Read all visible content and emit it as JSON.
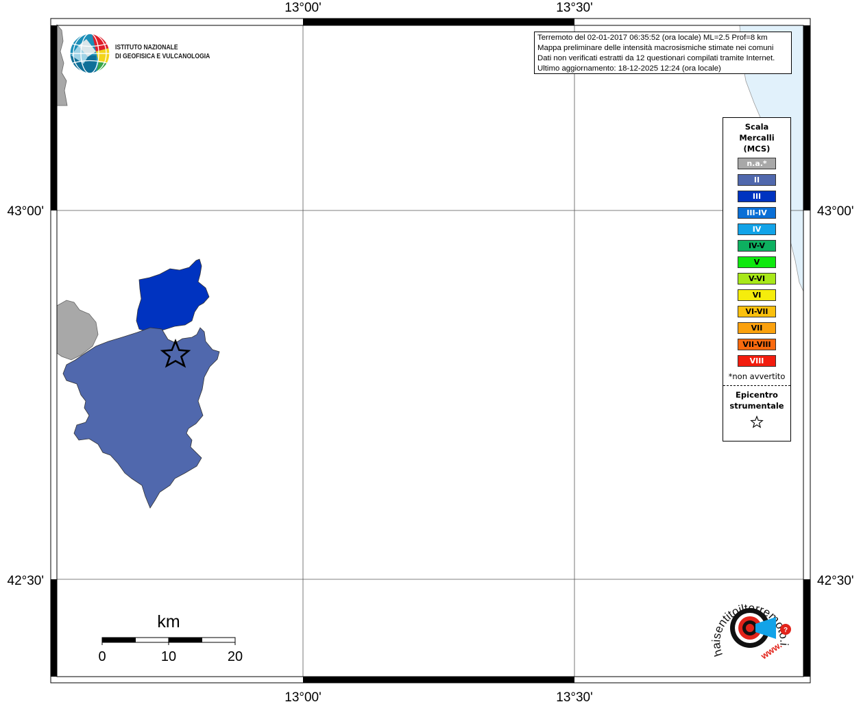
{
  "map": {
    "top_lon_labels": [
      "13°00'",
      "13°30'"
    ],
    "bottom_lon_labels": [
      "13°00'",
      "13°30'"
    ],
    "left_lat_labels": [
      "43°00'",
      "42°30'"
    ],
    "right_lat_labels": [
      "43°00'",
      "42°30'"
    ]
  },
  "info": {
    "line1": "Terremoto del 02-01-2017 06:35:52 (ora locale) ML=2.5 Prof=8 km",
    "line2": "Mappa preliminare delle intensità macrosismiche stimate nei comuni",
    "line3": "Dati non verificati estratti da 12 questionari compilati tramite Internet.",
    "line4": "Ultimo aggiornamento: 18-12-2025 12:24 (ora locale)"
  },
  "institute": {
    "name_line1": "ISTITUTO NAZIONALE",
    "name_line2": "DI GEOFISICA E VULCANOLOGIA"
  },
  "legend": {
    "title_line1": "Scala",
    "title_line2": "Mercalli",
    "title_line3": "(MCS)",
    "classes": [
      {
        "label": "n.a.*",
        "color": "#a8a8a8",
        "text_color": "#ffffff"
      },
      {
        "label": "II",
        "color": "#5068ad",
        "text_color": "#ffffff"
      },
      {
        "label": "III",
        "color": "#0033c0",
        "text_color": "#ffffff"
      },
      {
        "label": "III-IV",
        "color": "#0a6fd6",
        "text_color": "#ffffff"
      },
      {
        "label": "IV",
        "color": "#12a3e8",
        "text_color": "#ffffff"
      },
      {
        "label": "IV-V",
        "color": "#0db060",
        "text_color": "#000000"
      },
      {
        "label": "V",
        "color": "#0ee80e",
        "text_color": "#000000"
      },
      {
        "label": "V-VI",
        "color": "#a8e81a",
        "text_color": "#000000"
      },
      {
        "label": "VI",
        "color": "#f5ed0c",
        "text_color": "#000000"
      },
      {
        "label": "VI-VII",
        "color": "#fbc00d",
        "text_color": "#000000"
      },
      {
        "label": "VII",
        "color": "#fba10d",
        "text_color": "#000000"
      },
      {
        "label": "VII-VIII",
        "color": "#f9690e",
        "text_color": "#000000"
      },
      {
        "label": "VIII",
        "color": "#f21c0e",
        "text_color": "#ffffff"
      }
    ],
    "note": "*non avvertito",
    "epicenter_line1": "Epicentro",
    "epicenter_line2": "strumentale"
  },
  "scalebar": {
    "unit": "km",
    "ticks": [
      "0",
      "10",
      "20"
    ]
  },
  "haisentito": {
    "text": "haisentitoilterremoto.it",
    "www": "www."
  },
  "colors": {
    "intensity_II": "#5068ad",
    "intensity_III": "#0033c0",
    "not_available": "#a8a8a8",
    "sea": "#e1f1fb",
    "grid": "#555555"
  }
}
